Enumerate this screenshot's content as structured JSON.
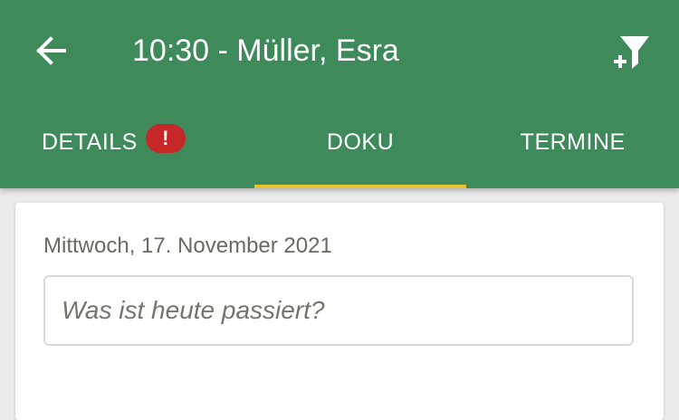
{
  "colors": {
    "brand": "#3e8a5a",
    "accent": "#e8c02c",
    "badge": "#c62828"
  },
  "header": {
    "title": "10:30 - Müller, Esra",
    "back_icon": "arrow-left-icon",
    "filter_icon": "filter-add-icon"
  },
  "tabs": [
    {
      "label": "DETAILS",
      "badge": "!",
      "active": false
    },
    {
      "label": "DOKU",
      "active": true
    },
    {
      "label": "TERMINE",
      "active": false
    }
  ],
  "card": {
    "date": "Mittwoch, 17. November 2021",
    "entry": {
      "placeholder": "Was ist heute passiert?",
      "value": ""
    }
  }
}
